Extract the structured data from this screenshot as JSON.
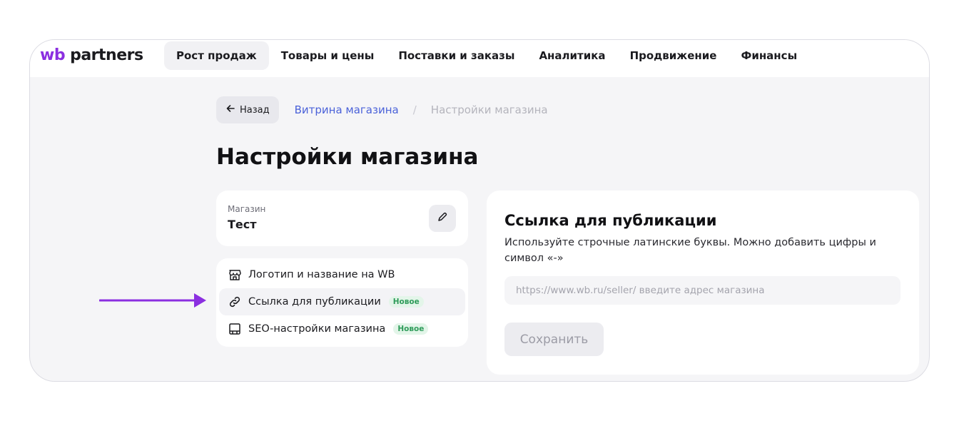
{
  "brand": {
    "logo_wb": "wb",
    "logo_partners": "partners",
    "logo_color": "#8b2fe0"
  },
  "nav": {
    "items": [
      {
        "label": "Рост продаж",
        "active": true
      },
      {
        "label": "Товары и цены",
        "active": false
      },
      {
        "label": "Поставки и заказы",
        "active": false
      },
      {
        "label": "Аналитика",
        "active": false
      },
      {
        "label": "Продвижение",
        "active": false
      },
      {
        "label": "Финансы",
        "active": false
      }
    ]
  },
  "breadcrumb": {
    "back_label": "Назад",
    "parent": "Витрина магазина",
    "separator": "/",
    "current": "Настройки магазина"
  },
  "page": {
    "title": "Настройки магазина"
  },
  "store": {
    "label": "Магазин",
    "name": "Тест"
  },
  "menu": {
    "items": [
      {
        "label": "Логотип и название на WB",
        "icon": "shop-icon",
        "badge": ""
      },
      {
        "label": "Ссылка для публикации",
        "icon": "link-icon",
        "badge": "Новое",
        "selected": true
      },
      {
        "label": "SEO-настройки магазина",
        "icon": "layout-icon",
        "badge": "Новое"
      }
    ]
  },
  "content": {
    "title": "Ссылка для публикации",
    "description": "Используйте строчные латинские буквы. Можно добавить цифры и символ «-»",
    "input_value": "",
    "input_placeholder": "https://www.wb.ru/seller/ введите адрес магазина",
    "save_label": "Сохранить"
  },
  "colors": {
    "accent": "#8b2fe0",
    "link": "#4b62d9",
    "badge_text": "#2f9c5a",
    "badge_bg": "#e3f5e9"
  }
}
